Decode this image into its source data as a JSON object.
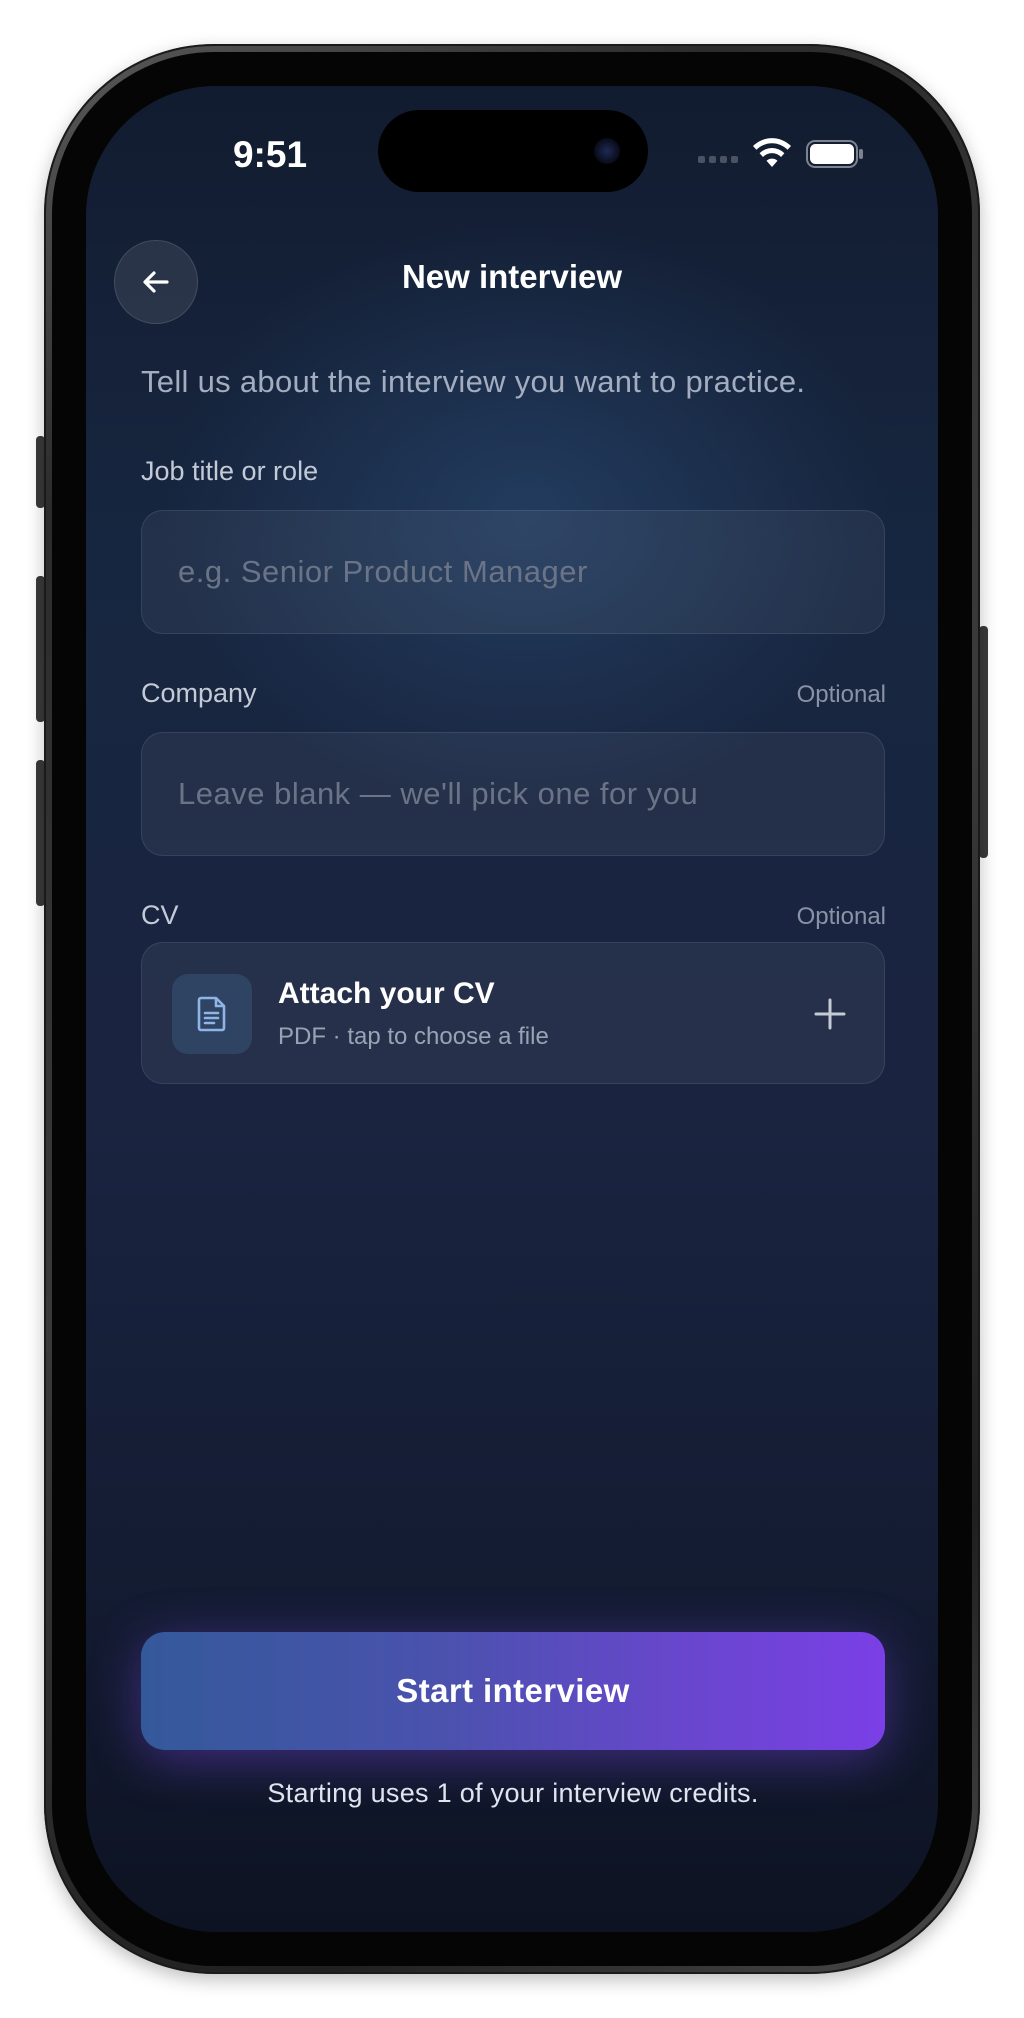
{
  "status_bar": {
    "time": "9:51"
  },
  "header": {
    "back_icon": "arrow-left-icon",
    "title": "New interview"
  },
  "intro": "Tell us about the interview you want to practice.",
  "form": {
    "job_title": {
      "label": "Job title or role",
      "value": "",
      "placeholder": "e.g. Senior Product Manager"
    },
    "company": {
      "label": "Company",
      "optional_label": "Optional",
      "value": "",
      "placeholder": "Leave blank — we'll pick one for you"
    },
    "cv": {
      "label": "CV",
      "optional_label": "Optional",
      "attach_title": "Attach your CV",
      "attach_subtitle": "PDF · tap to choose a file",
      "file_icon": "document-icon",
      "add_icon": "plus-icon"
    }
  },
  "footer": {
    "start_label": "Start interview",
    "credits_note": "Starting uses 1 of your interview credits."
  },
  "colors": {
    "background_top": "#121c30",
    "background_bottom": "#0d1322",
    "accent_start": "#34599a",
    "accent_end": "#7a3fe6",
    "field_placeholder": "#6b7487"
  }
}
